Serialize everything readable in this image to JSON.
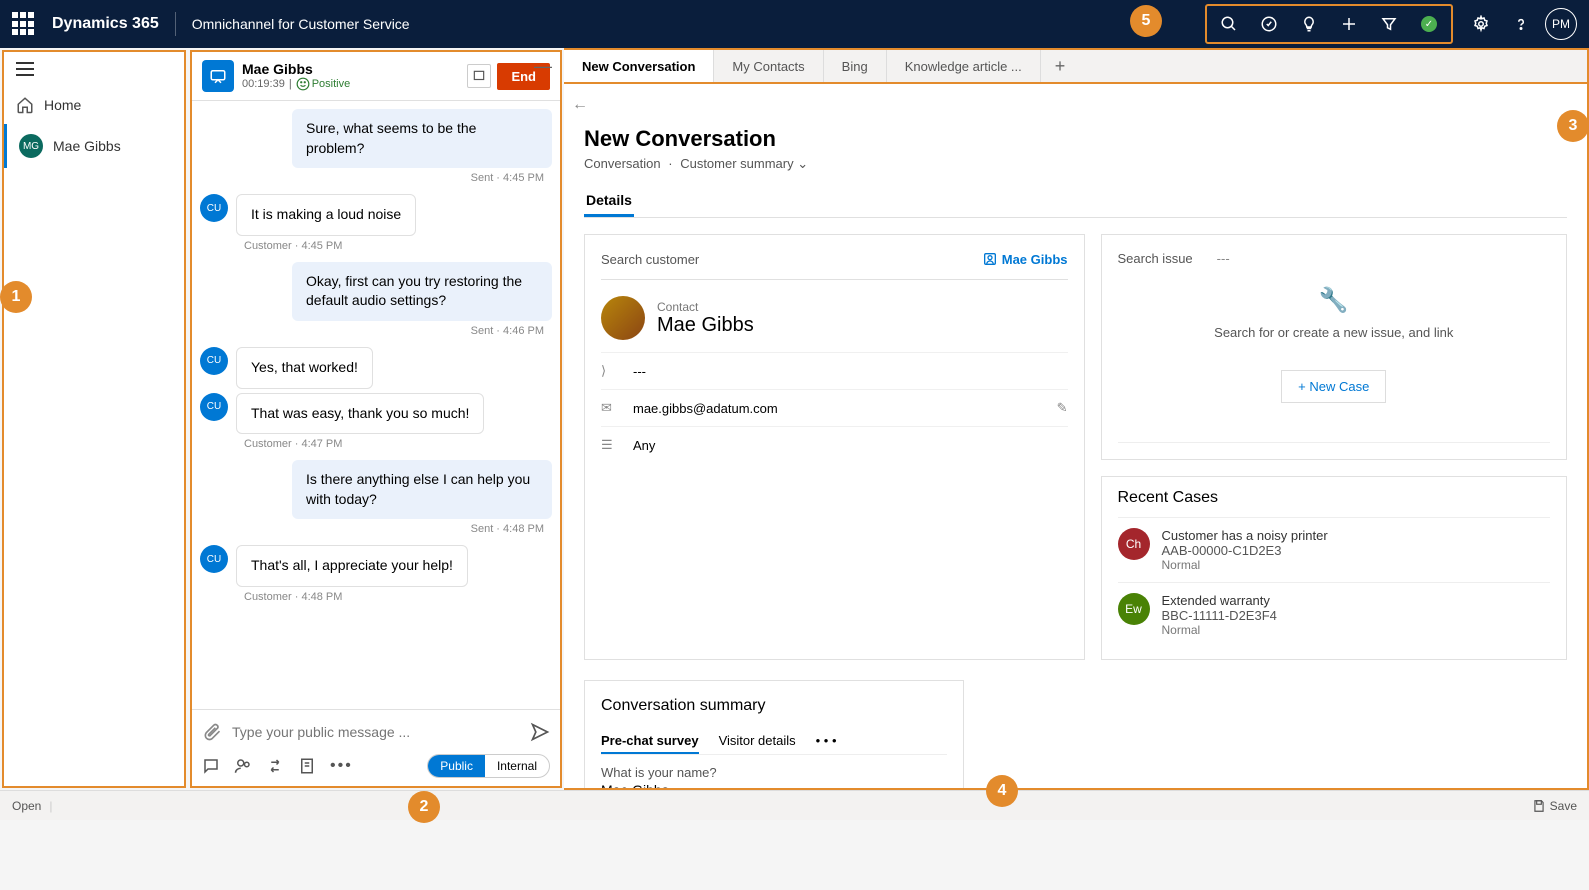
{
  "topbar": {
    "brand": "Dynamics 365",
    "app": "Omnichannel for Customer Service",
    "user_initials": "PM"
  },
  "sidebar": {
    "home": "Home",
    "session": {
      "initials": "MG",
      "name": "Mae Gibbs"
    }
  },
  "conversation": {
    "customer": "Mae Gibbs",
    "timer": "00:19:39",
    "sentiment": "Positive",
    "end_label": "End",
    "input_placeholder": "Type your public message ...",
    "pill_public": "Public",
    "pill_internal": "Internal",
    "messages": [
      {
        "dir": "out",
        "text": "Sure, what seems to be the problem?",
        "meta": "Sent · 4:45 PM"
      },
      {
        "dir": "in",
        "text": "It is making a loud noise",
        "meta": "Customer · 4:45 PM",
        "avatar": "CU"
      },
      {
        "dir": "out",
        "text": "Okay, first can you try restoring the default audio settings?",
        "meta": "Sent · 4:46 PM"
      },
      {
        "dir": "in",
        "text": "Yes, that worked!",
        "avatar": "CU"
      },
      {
        "dir": "in",
        "text": "That was easy, thank you so much!",
        "meta": "Customer · 4:47 PM",
        "avatar": "CU"
      },
      {
        "dir": "out",
        "text": "Is there anything else I can help you with today?",
        "meta": "Sent · 4:48 PM"
      },
      {
        "dir": "in",
        "text": "That's all, I appreciate your help!",
        "meta": "Customer · 4:48 PM",
        "avatar": "CU"
      }
    ]
  },
  "tabs": [
    {
      "label": "New Conversation",
      "active": true
    },
    {
      "label": "My Contacts"
    },
    {
      "label": "Bing"
    },
    {
      "label": "Knowledge article ..."
    }
  ],
  "page": {
    "title": "New Conversation",
    "crumb1": "Conversation",
    "crumb2": "Customer summary",
    "section": "Details"
  },
  "customer_card": {
    "search_label": "Search customer",
    "link_name": "Mae Gibbs",
    "contact_label": "Contact",
    "contact_name": "Mae Gibbs",
    "field_dash": "---",
    "email": "mae.gibbs@adatum.com",
    "pref": "Any"
  },
  "issue_card": {
    "search_label": "Search issue",
    "dash": "---",
    "hint": "Search for or create a new issue, and link",
    "new_case": "+ New Case"
  },
  "recent": {
    "title": "Recent Cases",
    "cases": [
      {
        "badge": "Ch",
        "color": "red",
        "title": "Customer has a noisy printer",
        "id": "AAB-00000-C1D2E3",
        "pri": "Normal"
      },
      {
        "badge": "Ew",
        "color": "green",
        "title": "Extended warranty",
        "id": "BBC-11111-D2E3F4",
        "pri": "Normal"
      }
    ]
  },
  "summary": {
    "title": "Conversation summary",
    "tab1": "Pre-chat survey",
    "tab2": "Visitor details",
    "more": "• • •",
    "q1": "What is your name?",
    "a1": "Mae Gibbs"
  },
  "statusbar": {
    "open": "Open",
    "save": "Save"
  },
  "callouts": {
    "c1": "1",
    "c2": "2",
    "c3": "3",
    "c4": "4",
    "c5": "5"
  }
}
